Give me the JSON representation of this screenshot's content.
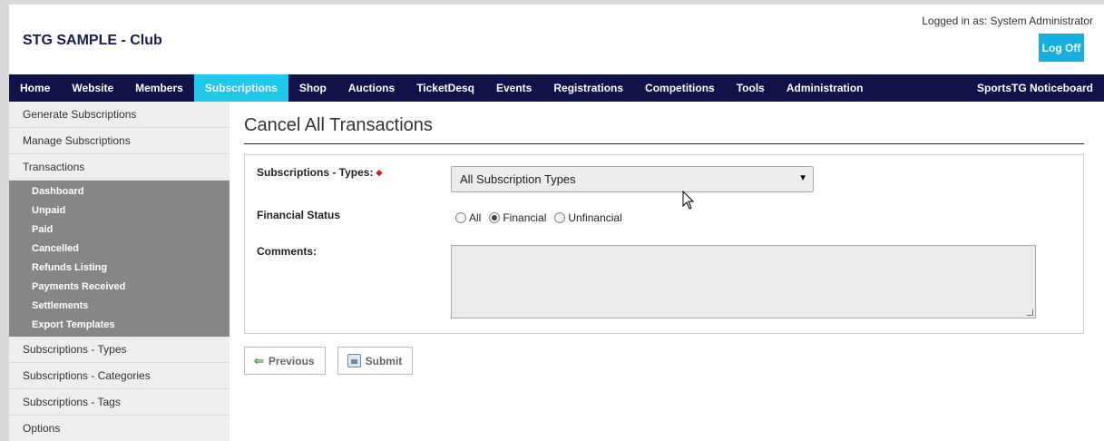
{
  "header": {
    "club_name": "STG SAMPLE - Club",
    "logged_in": "Logged in as: System Administrator",
    "logoff_label": "Log Off"
  },
  "nav": {
    "items": [
      "Home",
      "Website",
      "Members",
      "Subscriptions",
      "Shop",
      "Auctions",
      "TicketDesq",
      "Events",
      "Registrations",
      "Competitions",
      "Tools",
      "Administration"
    ],
    "active": "Subscriptions",
    "right_item": "SportsTG Noticeboard"
  },
  "sidebar": {
    "top_items": [
      "Generate Subscriptions",
      "Manage Subscriptions",
      "Transactions"
    ],
    "sub_items": [
      "Dashboard",
      "Unpaid",
      "Paid",
      "Cancelled",
      "Refunds Listing",
      "Payments Received",
      "Settlements",
      "Export Templates"
    ],
    "bottom_items": [
      "Subscriptions - Types",
      "Subscriptions - Categories",
      "Subscriptions - Tags",
      "Options"
    ]
  },
  "main": {
    "title": "Cancel All Transactions",
    "form": {
      "types_label": "Subscriptions - Types:",
      "types_value": "All Subscription Types",
      "status_label": "Financial Status",
      "status_options": [
        "All",
        "Financial",
        "Unfinancial"
      ],
      "status_selected": "Financial",
      "comments_label": "Comments:",
      "comments_value": ""
    },
    "buttons": {
      "previous": "Previous",
      "submit": "Submit"
    }
  },
  "icons": {
    "required": "required-marker-icon",
    "select_arrow": "dropdown-arrow-icon",
    "previous": "arrow-left-icon",
    "submit": "save-icon",
    "cursor": "mouse-pointer-icon"
  },
  "colors": {
    "nav_bg": "#12124a",
    "nav_active": "#1ec8ea",
    "logoff_bg": "#17aee0",
    "submenu_bg": "#868686"
  }
}
